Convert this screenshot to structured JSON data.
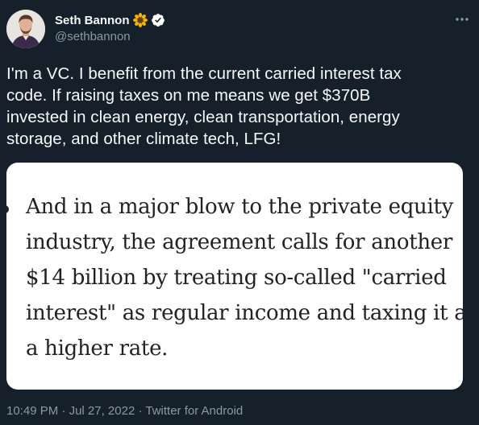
{
  "author": {
    "display_name": "Seth Bannon",
    "handle": "@sethbannon",
    "name_emoji": "sunflower-emoji",
    "verified": true,
    "avatar": "avatar-photo"
  },
  "menu": {
    "icon": "more-horizontal-icon"
  },
  "tweet": {
    "text": "I'm a VC. I benefit from the current carried interest tax\ncode. If raising taxes on me means we get $370B\ninvested in clean energy, clean transportation, energy\nstorage, and other climate tech, LFG!"
  },
  "media": {
    "lines": [
      "And in a major blow to the private equity",
      "industry, the agreement calls for another",
      "$14 billion by treating so-called \"carried",
      "interest\" as regular income and taxing it at",
      "a higher rate."
    ]
  },
  "meta": {
    "time": "10:49 PM",
    "separator": " · ",
    "date": "Jul 27, 2022",
    "source": "Twitter for Android"
  },
  "colors": {
    "background": "#15202b",
    "text": "#f7f9f9",
    "secondary_text": "#8b98a5",
    "verified_badge": "#ffffff",
    "media_background": "#ffffff"
  }
}
